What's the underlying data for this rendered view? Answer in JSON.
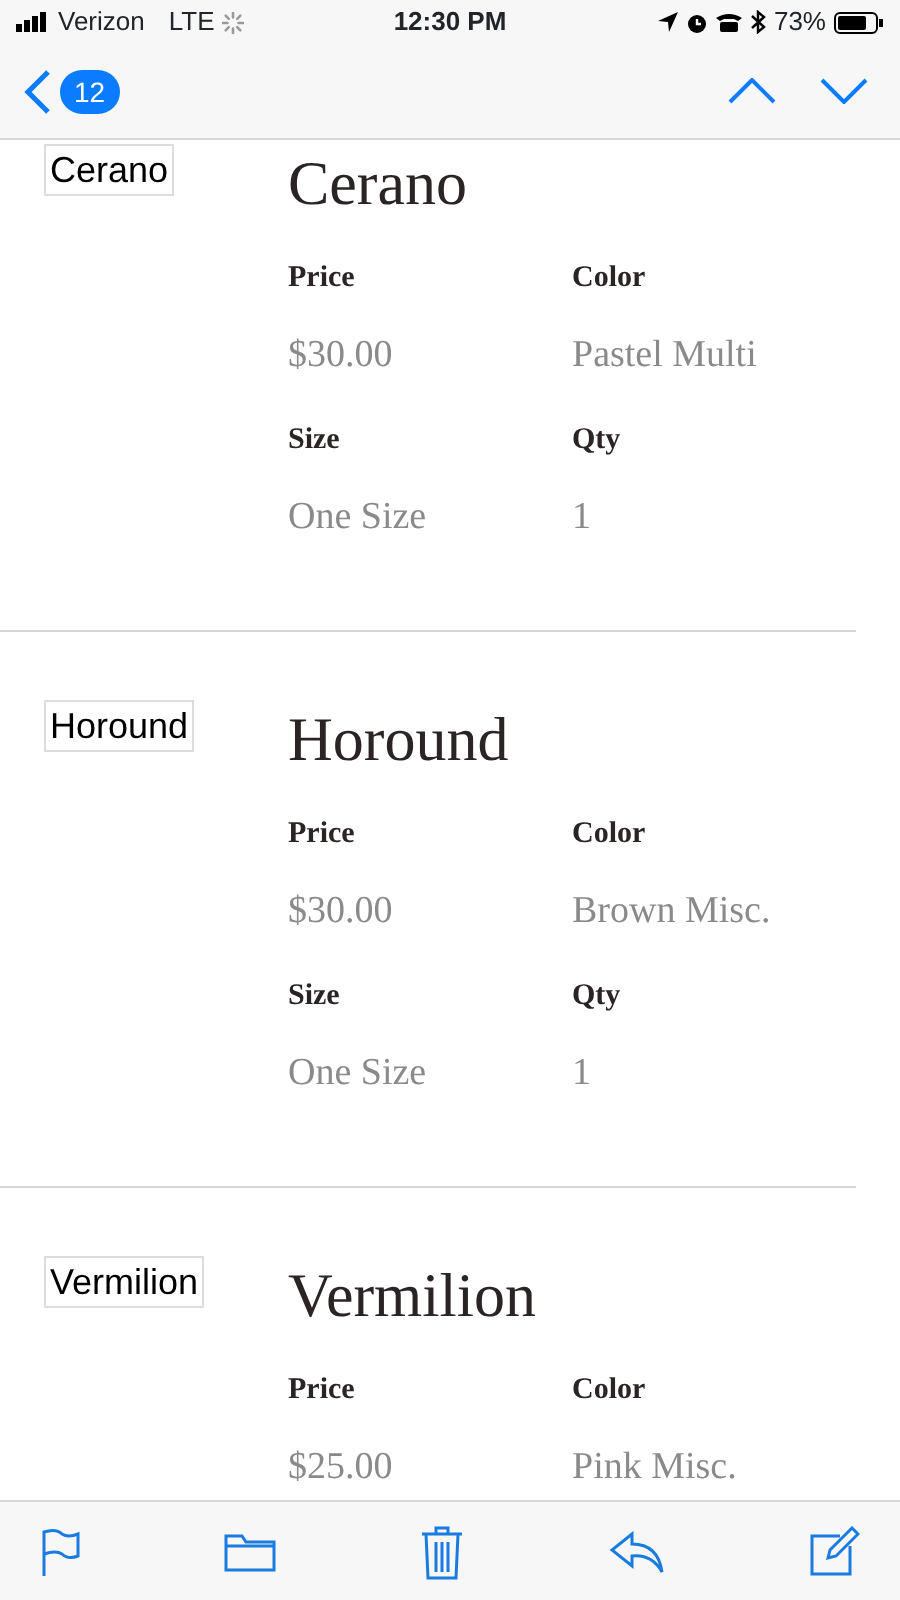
{
  "status_bar": {
    "carrier": "Verizon",
    "network": "LTE",
    "time": "12:30 PM",
    "battery": "73%"
  },
  "nav_bar": {
    "unread_count": "12"
  },
  "items": [
    {
      "image_alt": "Cerano",
      "title": "Cerano",
      "fields": [
        {
          "label": "Price",
          "value": "$30.00"
        },
        {
          "label": "Color",
          "value": "Pastel Multi"
        },
        {
          "label": "Size",
          "value": "One Size"
        },
        {
          "label": "Qty",
          "value": "1"
        }
      ]
    },
    {
      "image_alt": "Horound",
      "title": "Horound",
      "fields": [
        {
          "label": "Price",
          "value": "$30.00"
        },
        {
          "label": "Color",
          "value": "Brown Misc."
        },
        {
          "label": "Size",
          "value": "One Size"
        },
        {
          "label": "Qty",
          "value": "1"
        }
      ]
    },
    {
      "image_alt": "Vermilion",
      "title": "Vermilion",
      "fields": [
        {
          "label": "Price",
          "value": "$25.00"
        },
        {
          "label": "Color",
          "value": "Pink Misc."
        }
      ]
    }
  ]
}
